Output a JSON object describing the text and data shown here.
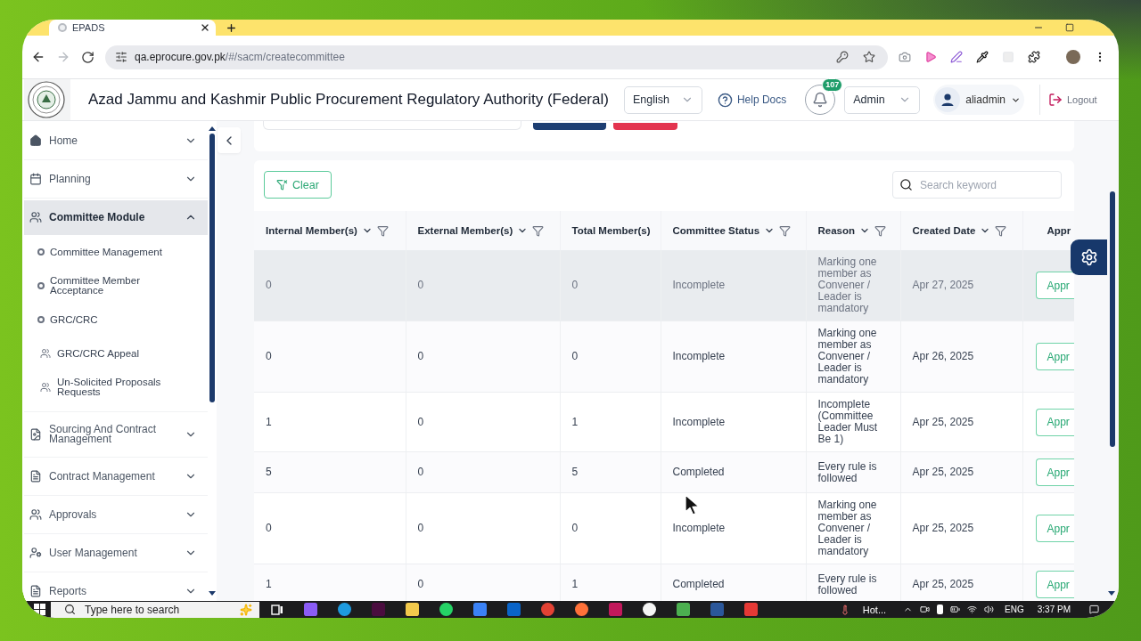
{
  "browser": {
    "tab_title": "EPADS",
    "url_host": "qa.eprocure.gov.pk",
    "url_path": "/#/sacm/createcommittee",
    "forward_disabled": true
  },
  "header": {
    "title": "Azad Jammu and Kashmir Public Procurement Regulatory Authority (Federal)",
    "language": "English",
    "help": "Help Docs",
    "notification_count": "107",
    "role": "Admin",
    "user": "aliadmin",
    "logout": "Logout"
  },
  "sidebar": {
    "items": [
      {
        "label": "Home",
        "expanded": false
      },
      {
        "label": "Planning",
        "expanded": false
      },
      {
        "label": "Committee Module",
        "expanded": true,
        "children": [
          {
            "label": "Committee Management",
            "kind": "bullet"
          },
          {
            "label": "Committee Member Acceptance",
            "kind": "bullet"
          },
          {
            "label": "GRC/CRC",
            "kind": "bullet"
          },
          {
            "label": "GRC/CRC Appeal",
            "kind": "group"
          },
          {
            "label": "Un-Solicited Proposals Requests",
            "kind": "group"
          }
        ]
      },
      {
        "label": "Sourcing And Contract Management",
        "expanded": false
      },
      {
        "label": "Contract Management",
        "expanded": false
      },
      {
        "label": "Approvals",
        "expanded": false
      },
      {
        "label": "User Management",
        "expanded": false
      },
      {
        "label": "Reports",
        "expanded": false
      }
    ]
  },
  "toolbar": {
    "clear": "Clear",
    "search": {
      "placeholder": "Search keyword"
    }
  },
  "table": {
    "columns": [
      {
        "label": "Internal Member(s)",
        "kind": "data",
        "sortable": true,
        "filterable": true
      },
      {
        "label": "External Member(s)",
        "kind": "data",
        "sortable": true,
        "filterable": true
      },
      {
        "label": "Total Member(s)",
        "kind": "data",
        "sortable": false,
        "filterable": false
      },
      {
        "label": "Committee Status",
        "kind": "data",
        "sortable": true,
        "filterable": true
      },
      {
        "label": "Reason",
        "kind": "data",
        "sortable": true,
        "filterable": true
      },
      {
        "label": "Created Date",
        "kind": "data",
        "sortable": true,
        "filterable": true
      },
      {
        "label": "Appr",
        "kind": "action",
        "sortable": false,
        "filterable": false
      }
    ],
    "rows": [
      {
        "selected": true,
        "cells": [
          "0",
          "0",
          "0",
          "Incomplete",
          "Marking one member as Convener / Leader is mandatory",
          "Apr 27, 2025"
        ],
        "action": "Appr"
      },
      {
        "selected": false,
        "cells": [
          "0",
          "0",
          "0",
          "Incomplete",
          "Marking one member as Convener / Leader is mandatory",
          "Apr 26, 2025"
        ],
        "action": "Appr"
      },
      {
        "selected": false,
        "cells": [
          "1",
          "0",
          "1",
          "Incomplete",
          "Incomplete (Committee Leader Must Be 1)",
          "Apr 25, 2025"
        ],
        "action": "Appr"
      },
      {
        "selected": false,
        "cells": [
          "5",
          "0",
          "5",
          "Completed",
          "Every rule is followed",
          "Apr 25, 2025"
        ],
        "action": "Appr"
      },
      {
        "selected": false,
        "cells": [
          "0",
          "0",
          "0",
          "Incomplete",
          "Marking one member as Convener / Leader is mandatory",
          "Apr 25, 2025"
        ],
        "action": "Appr"
      },
      {
        "selected": false,
        "cells": [
          "1",
          "0",
          "1",
          "Completed",
          "Every rule is followed",
          "Apr 25, 2025"
        ],
        "action": "Appr"
      }
    ]
  },
  "taskbar": {
    "search": {
      "placeholder": "Type here to search"
    },
    "weather": "Hot...",
    "language": "ENG",
    "time": "3:37 PM"
  }
}
